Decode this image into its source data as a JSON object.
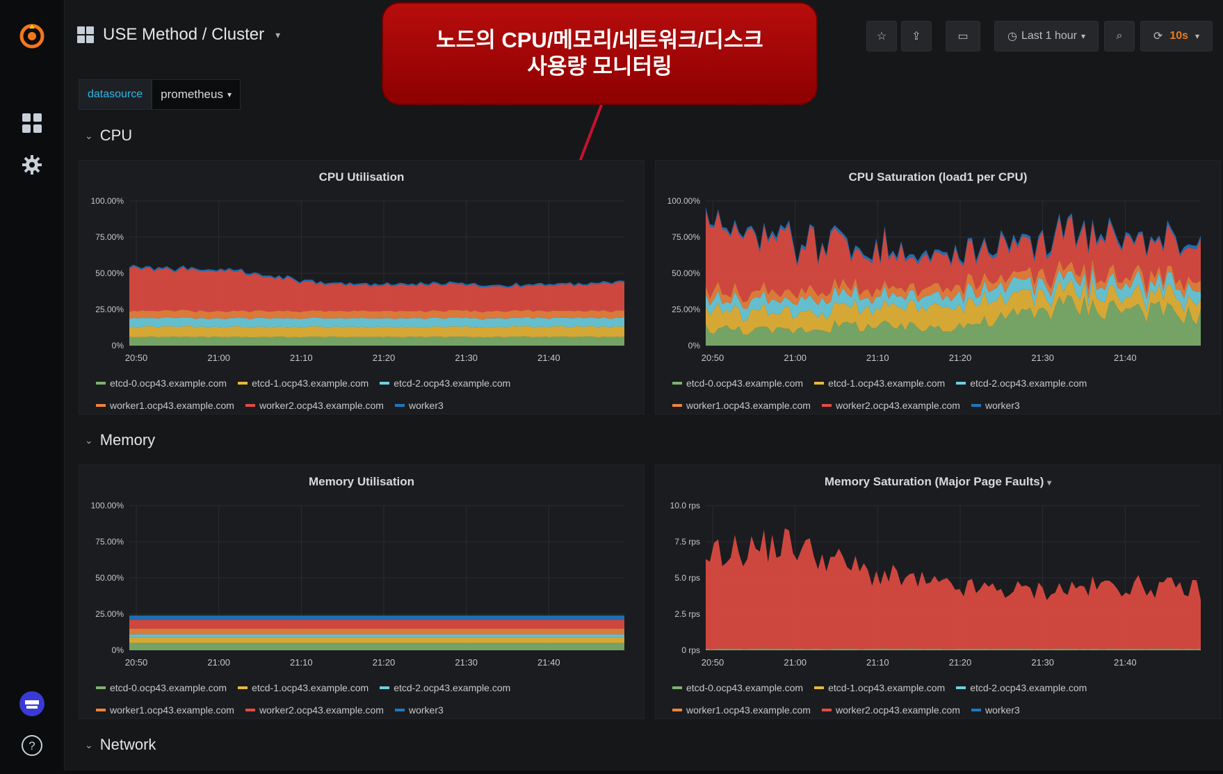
{
  "header": {
    "title": "USE Method / Cluster",
    "time_range": "Last 1 hour",
    "refresh": "10s"
  },
  "datasource": {
    "label": "datasource",
    "value": "prometheus"
  },
  "callout": {
    "line1": "노드의 CPU/메모리/네트워크/디스크",
    "line2": "사용량 모니터링"
  },
  "rows": {
    "cpu": "CPU",
    "memory": "Memory",
    "network": "Network"
  },
  "legend": [
    {
      "name": "etcd-0.ocp43.example.com",
      "color": "#7eb26d"
    },
    {
      "name": "etcd-1.ocp43.example.com",
      "color": "#eab839"
    },
    {
      "name": "etcd-2.ocp43.example.com",
      "color": "#6ed0e0"
    },
    {
      "name": "worker1.ocp43.example.com",
      "color": "#ef843c"
    },
    {
      "name": "worker2.ocp43.example.com",
      "color": "#e24d42"
    },
    {
      "name": "worker3",
      "color": "#1f78c1"
    }
  ],
  "colors": {
    "accent_red": "#b70d0d",
    "datasource_blue": "#33b5e5",
    "refresh_orange": "#eb7b18"
  },
  "chart_data": [
    {
      "id": "cpu_util",
      "type": "area",
      "stacked": true,
      "title": "CPU Utilisation",
      "x": [
        "20:50",
        "21:00",
        "21:10",
        "21:20",
        "21:30",
        "21:40"
      ],
      "yticks": [
        "100.00%",
        "75.00%",
        "50.00%",
        "25.00%",
        "0%"
      ],
      "ylim": [
        0,
        1
      ],
      "series": [
        {
          "name": "etcd-0.ocp43.example.com",
          "values": [
            0.06,
            0.06,
            0.06,
            0.06,
            0.06,
            0.06
          ]
        },
        {
          "name": "etcd-1.ocp43.example.com",
          "values": [
            0.07,
            0.07,
            0.07,
            0.07,
            0.07,
            0.07
          ]
        },
        {
          "name": "etcd-2.ocp43.example.com",
          "values": [
            0.06,
            0.06,
            0.06,
            0.06,
            0.06,
            0.06
          ]
        },
        {
          "name": "worker1.ocp43.example.com",
          "values": [
            0.05,
            0.05,
            0.05,
            0.05,
            0.05,
            0.05
          ]
        },
        {
          "name": "worker2.ocp43.example.com",
          "values": [
            0.29,
            0.28,
            0.18,
            0.18,
            0.17,
            0.19
          ]
        },
        {
          "name": "worker3",
          "values": [
            0.01,
            0.01,
            0.01,
            0.01,
            0.01,
            0.01
          ]
        }
      ]
    },
    {
      "id": "cpu_sat",
      "type": "area",
      "stacked": true,
      "title": "CPU Saturation (load1 per CPU)",
      "x": [
        "20:50",
        "21:00",
        "21:10",
        "21:20",
        "21:30",
        "21:40"
      ],
      "yticks": [
        "100.00%",
        "75.00%",
        "50.00%",
        "25.00%",
        "0%"
      ],
      "ylim": [
        0,
        1
      ],
      "series": [
        {
          "name": "etcd-0.ocp43.example.com",
          "values": [
            0.12,
            0.1,
            0.14,
            0.12,
            0.16,
            0.28,
            0.26,
            0.2
          ]
        },
        {
          "name": "etcd-1.ocp43.example.com",
          "values": [
            0.14,
            0.12,
            0.12,
            0.13,
            0.14,
            0.1,
            0.1,
            0.1
          ]
        },
        {
          "name": "etcd-2.ocp43.example.com",
          "values": [
            0.07,
            0.08,
            0.08,
            0.08,
            0.08,
            0.07,
            0.08,
            0.08
          ]
        },
        {
          "name": "worker1.ocp43.example.com",
          "values": [
            0.05,
            0.06,
            0.05,
            0.06,
            0.06,
            0.06,
            0.05,
            0.06
          ]
        },
        {
          "name": "worker2.ocp43.example.com",
          "values": [
            0.42,
            0.36,
            0.3,
            0.24,
            0.22,
            0.24,
            0.25,
            0.22
          ]
        },
        {
          "name": "worker3",
          "values": [
            0.02,
            0.02,
            0.02,
            0.02,
            0.02,
            0.02,
            0.02,
            0.02
          ]
        }
      ]
    },
    {
      "id": "mem_util",
      "type": "area",
      "stacked": true,
      "title": "Memory Utilisation",
      "x": [
        "20:50",
        "21:00",
        "21:10",
        "21:20",
        "21:30",
        "21:40"
      ],
      "yticks": [
        "100.00%",
        "75.00%",
        "50.00%",
        "25.00%",
        "0%"
      ],
      "ylim": [
        0,
        1
      ],
      "series": [
        {
          "name": "etcd-0.ocp43.example.com",
          "values": [
            0.05,
            0.05
          ]
        },
        {
          "name": "etcd-1.ocp43.example.com",
          "values": [
            0.04,
            0.04
          ]
        },
        {
          "name": "etcd-2.ocp43.example.com",
          "values": [
            0.02,
            0.02
          ]
        },
        {
          "name": "worker1.ocp43.example.com",
          "values": [
            0.04,
            0.04
          ]
        },
        {
          "name": "worker2.ocp43.example.com",
          "values": [
            0.06,
            0.06
          ]
        },
        {
          "name": "worker3",
          "values": [
            0.03,
            0.03
          ]
        }
      ]
    },
    {
      "id": "mem_sat",
      "type": "area",
      "stacked": true,
      "title": "Memory Saturation (Major Page Faults)",
      "x": [
        "20:50",
        "21:00",
        "21:10",
        "21:20",
        "21:30",
        "21:40"
      ],
      "yticks": [
        "10.0 rps",
        "7.5 rps",
        "5.0 rps",
        "2.5 rps",
        "0 rps"
      ],
      "ylim": [
        0,
        10
      ],
      "series": [
        {
          "name": "etcd-0.ocp43.example.com",
          "values": [
            0.1,
            0.1,
            0.1,
            0.1,
            0.1,
            0.1,
            0.1
          ]
        },
        {
          "name": "worker2.ocp43.example.com",
          "values": [
            6.5,
            7.3,
            5.2,
            4.2,
            4.0,
            4.4,
            4.1
          ]
        }
      ]
    }
  ]
}
